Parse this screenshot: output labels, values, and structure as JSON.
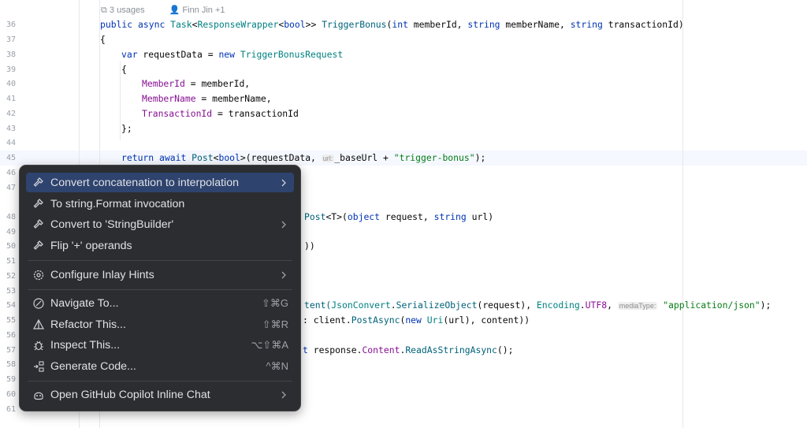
{
  "codelens": {
    "usages": "3 usages",
    "authors": "Finn Jin +1"
  },
  "gutter": [
    "36",
    "37",
    "38",
    "39",
    "40",
    "41",
    "42",
    "43",
    "44",
    "45",
    "46",
    "47",
    "48",
    "49",
    "50",
    "51",
    "52",
    "53",
    "54",
    "55",
    "56",
    "57",
    "58",
    "59",
    "60",
    "61"
  ],
  "code": {
    "l36": {
      "a": "public",
      "b": "async",
      "c": "Task",
      "d": "<",
      "e": "ResponseWrapper",
      "f": "<",
      "g": "bool",
      "h": ">>",
      "i": "TriggerBonus",
      "j": "(",
      "k": "int",
      "l": " memberId, ",
      "m": "string",
      "n": " memberName, ",
      "o": "string",
      "p": " transactionId)"
    },
    "l37": "{",
    "l38": {
      "a": "var",
      "b": " requestData = ",
      "c": "new",
      "d": "TriggerBonusRequest"
    },
    "l39": "{",
    "l40": {
      "a": "MemberId",
      "b": " = memberId,"
    },
    "l41": {
      "a": "MemberName",
      "b": " = memberName,"
    },
    "l42": {
      "a": "TransactionId",
      "b": " = transactionId"
    },
    "l43": "};",
    "l45": {
      "a": "return",
      "b": "await",
      "c": "Post",
      "d": "<",
      "e": "bool",
      "f": ">(requestData, ",
      "hint": "url:",
      "g": "_baseUrl + ",
      "h": "\"trigger-bonus\"",
      "i": ");"
    },
    "l48": {
      "a": "Post",
      "b": "<T>(",
      "c": "object",
      "d": " request, ",
      "e": "string",
      "f": " url)"
    },
    "l50": "))",
    "l54": {
      "a": "tent(",
      "b": "JsonConvert",
      "c": ".",
      "d": "SerializeObject",
      "e": "(request), ",
      "f": "Encoding",
      "g": ".",
      "h": "UTF8",
      "i": ", ",
      "hint": "mediaType:",
      "j": "\"application/json\"",
      "k": ");"
    },
    "l55": {
      "a": ": client.",
      "b": "PostAsync",
      "c": "(",
      "d": "new",
      "e": "Uri",
      "f": "(url), content))"
    },
    "l57": {
      "a": "t",
      "b": " response.",
      "c": "Content",
      "d": ".",
      "e": "ReadAsStringAsync",
      "f": "();"
    }
  },
  "menu": {
    "items": [
      {
        "label": "Convert concatenation to interpolation",
        "icon": "hammer-icon",
        "submenu": true,
        "selected": true
      },
      {
        "label": "To string.Format invocation",
        "icon": "hammer-icon"
      },
      {
        "label": "Convert to 'StringBuilder'",
        "icon": "hammer-icon",
        "submenu": true
      },
      {
        "label": "Flip '+' operands",
        "icon": "hammer-icon"
      },
      {
        "label": "Configure Inlay Hints",
        "icon": "gear-icon",
        "submenu": true
      },
      {
        "label": "Navigate To...",
        "icon": "navigate-icon",
        "shortcut": "⇧⌘G"
      },
      {
        "label": "Refactor This...",
        "icon": "refactor-icon",
        "shortcut": "⇧⌘R"
      },
      {
        "label": "Inspect This...",
        "icon": "inspect-icon",
        "shortcut": "⌥⇧⌘A"
      },
      {
        "label": "Generate Code...",
        "icon": "generate-icon",
        "shortcut": "^⌘N"
      },
      {
        "label": "Open GitHub Copilot Inline Chat",
        "icon": "copilot-icon",
        "submenu": true
      }
    ]
  },
  "colors": {
    "menu_bg": "#2b2d30",
    "selection": "#2e436e",
    "keyword": "#0033b3",
    "type": "#008080",
    "string": "#067d17",
    "property": "#871094"
  }
}
